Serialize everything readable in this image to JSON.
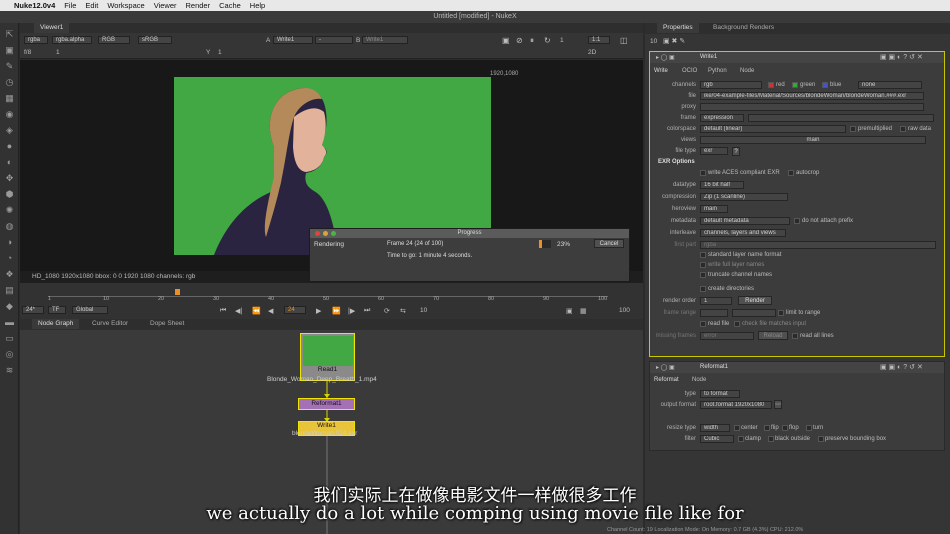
{
  "menubar": {
    "app": "Nuke12.0v4",
    "items": [
      "File",
      "Edit",
      "Workspace",
      "Viewer",
      "Render",
      "Cache",
      "Help"
    ]
  },
  "window": {
    "title": "Untitled [modified] - NukeX"
  },
  "viewer": {
    "tab": "Viewer1",
    "channels": "rgba",
    "layer": "rgba.alpha",
    "display": "RGB",
    "colorspace": "sRGB",
    "input_a_label": "A",
    "input_a": "Write1",
    "input_dash": "-",
    "input_b_label": "B",
    "input_b": "Write1",
    "gain_label": "f/8",
    "gain": "1",
    "gamma_label": "Y",
    "gamma": "1",
    "zoom": "1:1",
    "mode": "2D",
    "format_label": "1920,1080",
    "info": "HD_1080 1920x1080  bbox: 0 0 1920 1080 channels: rgb"
  },
  "timeline": {
    "ticks": [
      "1",
      "10",
      "20",
      "30",
      "40",
      "50",
      "60",
      "70",
      "80",
      "90",
      "100"
    ],
    "fps": "24*",
    "tf": "TF",
    "scope": "Global",
    "frame": "24",
    "step": "10",
    "end": "100",
    "playhead_fraction": 0.23
  },
  "progress": {
    "title": "Progress",
    "task": "Rendering",
    "frame_text": "Frame 24 (24 of 100)",
    "time_text": "Time to go: 1 minute 4 seconds.",
    "percent_label": "23%",
    "percent": 0.23,
    "cancel": "Cancel"
  },
  "nodegraph": {
    "tabs": [
      "Node Graph",
      "Curve Editor",
      "Dope Sheet"
    ],
    "read_node": "Read1",
    "read_file": "Blonde_Woman_Deep_Breath_1.mp4",
    "reformat_node": "Reformat1",
    "write_node": "Write1",
    "write_file": "blondeWoman.024.exr"
  },
  "properties": {
    "tabs": [
      "Properties",
      "Background Renders"
    ],
    "max_panels": "10",
    "write": {
      "name": "Write1",
      "tabs": [
        "Write",
        "OCIO",
        "Python",
        "Node"
      ],
      "channels_label": "channels",
      "channels": "rgb",
      "red": "red",
      "green": "green",
      "blue": "blue",
      "alpha": "none",
      "file_label": "file",
      "file": "ike/04-example-files/Material/Sources/blondeWoman/blondeWoman.###.exr",
      "proxy_label": "proxy",
      "frame_label": "frame",
      "frame": "expression",
      "colorspace_label": "colorspace",
      "colorspace": "default (linear)",
      "premultiplied": "premultiplied",
      "raw_data": "raw data",
      "views_label": "views",
      "views": "main",
      "file_type_label": "file type",
      "file_type": "exr",
      "exr_header": "EXR Options",
      "aces": "write ACES compliant EXR",
      "autocrop": "autocrop",
      "datatype_label": "datatype",
      "datatype": "16 bit half",
      "compression_label": "compression",
      "compression": "Zip (1 scanline)",
      "heroview_label": "heroview",
      "heroview": "main",
      "metadata_label": "metadata",
      "metadata": "default metadata",
      "no_prefix": "do not attach prefix",
      "interleave_label": "interleave",
      "interleave": "channels, layers and views",
      "first_part_label": "first part",
      "first_part": "rgba",
      "std_layer": "standard layer name format",
      "full_layer": "write full layer names",
      "truncate": "truncate channel names",
      "create_dirs": "create directories",
      "render_order_label": "render order",
      "render_order": "1",
      "render_button": "Render",
      "frame_range_label": "frame range",
      "limit_range": "limit to range",
      "read_file": "read file",
      "check_file": "check file matches input",
      "missing_frames_label": "missing frames",
      "missing_frames": "error",
      "reload": "Reload",
      "read_all_lines": "read all lines"
    },
    "reformat": {
      "name": "Reformat1",
      "tabs": [
        "Reformat",
        "Node"
      ],
      "type_label": "type",
      "type": "to format",
      "output_format_label": "output format",
      "output_format": "root.format 1920x1080",
      "resize_label": "resize type",
      "resize": "width",
      "center": "center",
      "flip": "flip",
      "flop": "flop",
      "turn": "turn",
      "filter_label": "filter",
      "filter": "Cubic",
      "clamp": "clamp",
      "black_outside": "black outside",
      "preserve_bbox": "preserve bounding box"
    }
  },
  "status": "Channel Count: 19  Localization Mode: On  Memory: 0.7 GB (4.3%)  CPU: 212.0%",
  "subtitles": {
    "chinese": "我们实际上在做像电影文件一样做很多工作",
    "english": "we actually do a lot while comping using movie file like for"
  },
  "colors": {
    "green_screen": "#41a843",
    "read_node": "#8a8a8a",
    "reformat_node": "#a571b6",
    "write_node": "#e7c43a",
    "selection": "#f0e400",
    "progress": "#e8902a"
  }
}
